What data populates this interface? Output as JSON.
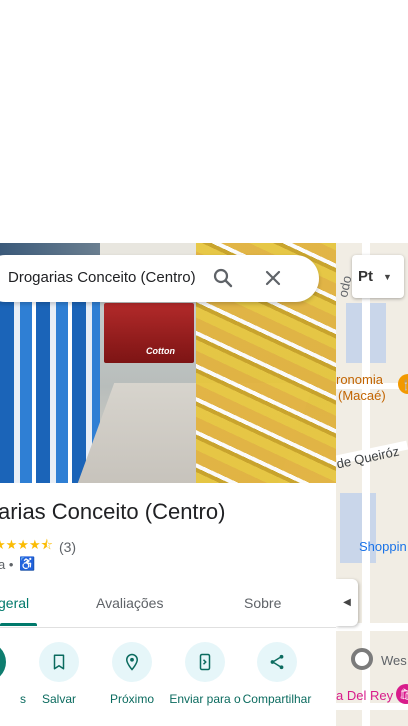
{
  "search": {
    "query": "Drogarias Conceito (Centro)"
  },
  "place": {
    "title": "arias Conceito (Centro)",
    "stars": "★★★★⯪",
    "review_count": "(3)",
    "category": "a •",
    "photo_text": "Cotton"
  },
  "tabs": [
    {
      "label": "geral"
    },
    {
      "label": "Avaliações"
    },
    {
      "label": "Sobre"
    }
  ],
  "actions": [
    {
      "label": "s"
    },
    {
      "label": "Salvar"
    },
    {
      "label": "Próximo"
    },
    {
      "label": "Enviar para o"
    },
    {
      "label": "Compartilhar"
    }
  ],
  "map": {
    "layer_button_label": "Pt",
    "labels": {
      "rodo": "odo",
      "tronomia": "ronomia",
      "macae": "(Macaé)",
      "queiroz": "de Queiróz",
      "shoppin": "Shoppin",
      "wes": "Wes",
      "del_rey": "a Del Rey"
    }
  },
  "colors": {
    "accent": "#00796b",
    "action_bg": "#e6f6f9",
    "star": "#fbbc04"
  }
}
